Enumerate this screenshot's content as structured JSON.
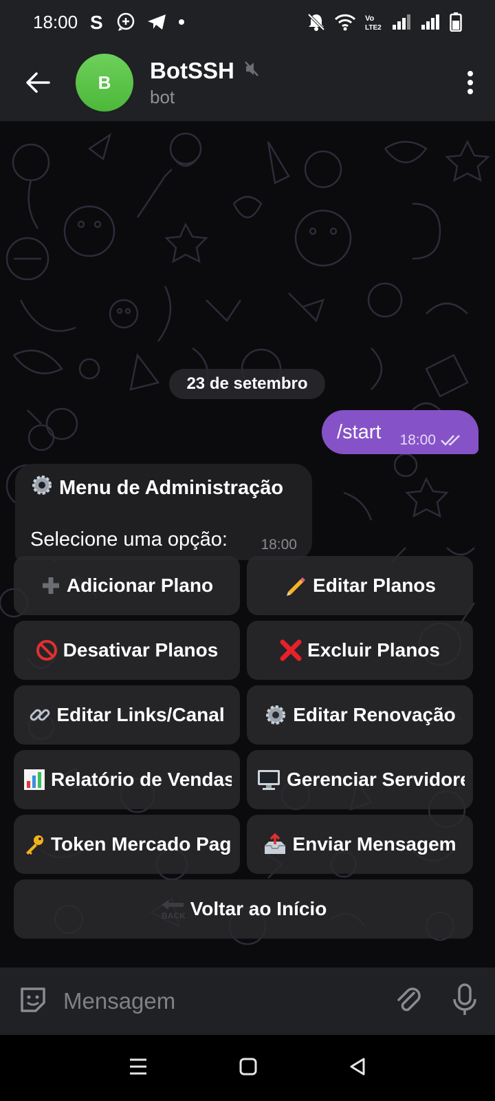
{
  "status_bar": {
    "time": "18:00",
    "icons": [
      "skype-icon",
      "chat-plus-icon",
      "telegram-icon",
      "dot-icon",
      "bell-off-icon",
      "wifi-icon",
      "volte-icon",
      "signal-icon",
      "signal-icon",
      "battery-icon"
    ],
    "volte_text": "Vo LTE2"
  },
  "header": {
    "avatar_letter": "B",
    "title": "BotSSH",
    "subtitle": "bot",
    "avatar_color": "#52c042"
  },
  "chat": {
    "date_label": "23 de setembro",
    "outgoing": {
      "text": "/start",
      "time": "18:00"
    },
    "incoming": {
      "title": "Menu de Administração",
      "body": "Selecione uma opção:",
      "time": "18:00"
    },
    "keyboard": [
      {
        "emoji": "plus",
        "label": "Adicionar Plano"
      },
      {
        "emoji": "pencil",
        "label": "Editar Planos"
      },
      {
        "emoji": "prohibited",
        "label": "Desativar Planos"
      },
      {
        "emoji": "cross",
        "label": "Excluir Planos"
      },
      {
        "emoji": "link",
        "label": "Editar Links/Canal"
      },
      {
        "emoji": "gear",
        "label": "Editar Renovação"
      },
      {
        "emoji": "chart",
        "label": "Relatório de Vendas"
      },
      {
        "emoji": "computer",
        "label": "Gerenciar Servidores"
      },
      {
        "emoji": "key",
        "label": "Token Mercado Pago"
      },
      {
        "emoji": "outbox",
        "label": "Enviar Mensagem"
      },
      {
        "emoji": "back",
        "label": "Voltar ao Início"
      }
    ],
    "back_emoji_text": "BACK"
  },
  "input": {
    "placeholder": "Mensagem"
  },
  "colors": {
    "bubble_out": "#8652c8",
    "bubble_in": "#1f1f22",
    "header_bg": "#202124"
  }
}
